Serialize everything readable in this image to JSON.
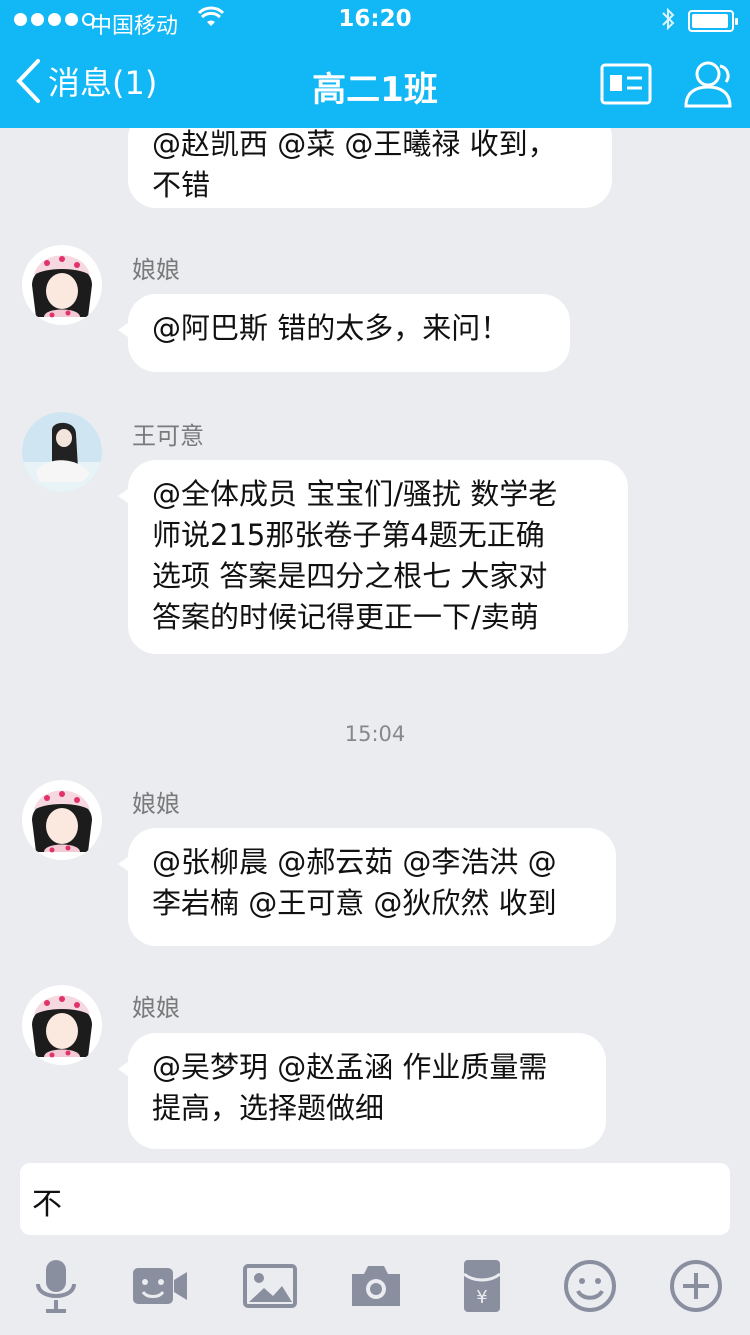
{
  "status_bar": {
    "carrier": "中国移动",
    "time": "16:20"
  },
  "nav": {
    "back_label": "消息(1)",
    "title": "高二1班"
  },
  "messages": [
    {
      "sender": "",
      "text": "@赵凯西 @菜 @王曦禄 收到，\n不错"
    },
    {
      "sender": "娘娘",
      "text": "@阿巴斯 错的太多，来问！"
    },
    {
      "sender": "王可意",
      "text": "@全体成员 宝宝们/骚扰 数学老\n师说215那张卷子第4题无正确\n选项 答案是四分之根七 大家对\n答案的时候记得更正一下/卖萌"
    },
    {
      "sender": "娘娘",
      "text": "@张柳晨 @郝云茹 @李浩洪 @\n李岩楠 @王可意 @狄欣然 收到"
    },
    {
      "sender": "娘娘",
      "text": "@吴梦玥 @赵孟涵 作业质量需\n提高，选择题做细"
    }
  ],
  "timestamp": "15:04",
  "input": {
    "value": "不"
  },
  "colors": {
    "header": "#12b7f5",
    "background": "#ebecf0",
    "icon_gray": "#8a8fa0"
  },
  "toolbar": [
    "mic-icon",
    "video-icon",
    "image-icon",
    "camera-icon",
    "red-packet-icon",
    "emoji-icon",
    "plus-icon"
  ]
}
